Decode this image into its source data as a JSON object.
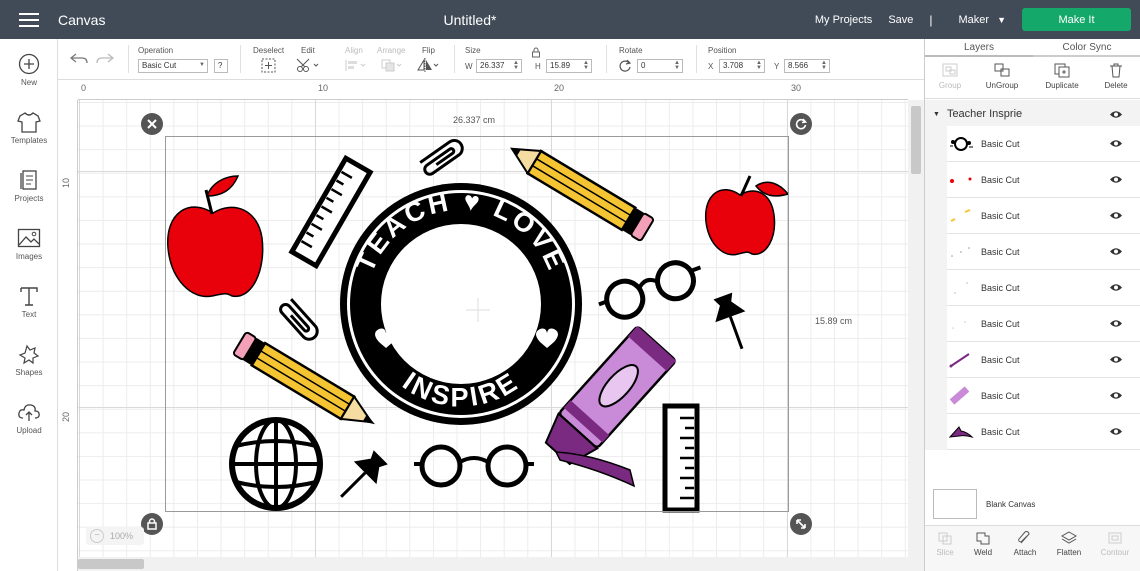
{
  "topbar": {
    "app_name": "Canvas",
    "doc_title": "Untitled*",
    "my_projects": "My Projects",
    "save": "Save",
    "separator": "|",
    "machine": "Maker",
    "make_it": "Make It"
  },
  "leftbar": {
    "new": "New",
    "templates": "Templates",
    "projects": "Projects",
    "images": "Images",
    "text": "Text",
    "shapes": "Shapes",
    "upload": "Upload"
  },
  "editbar": {
    "operation_label": "Operation",
    "operation_value": "Basic Cut",
    "help": "?",
    "deselect": "Deselect",
    "edit": "Edit",
    "align": "Align",
    "arrange": "Arrange",
    "flip": "Flip",
    "size_label": "Size",
    "w_label": "W",
    "w_value": "26.337",
    "h_label": "H",
    "h_value": "15.89",
    "rotate_label": "Rotate",
    "rotate_value": "0",
    "position_label": "Position",
    "x_label": "X",
    "x_value": "3.708",
    "y_label": "Y",
    "y_value": "8.566"
  },
  "ruler": {
    "h_ticks": [
      "0",
      "10",
      "20",
      "30"
    ],
    "v_ticks": [
      "10",
      "20"
    ]
  },
  "canvas": {
    "width_label": "26.337 cm",
    "height_label": "15.89 cm",
    "zoom": "100%"
  },
  "design": {
    "top_text": "TEACH ♥ LOVE",
    "bottom_text": "INSPIRE"
  },
  "panel": {
    "tab_layers": "Layers",
    "tab_color_sync": "Color Sync",
    "actions": {
      "group": "Group",
      "ungroup": "UnGroup",
      "duplicate": "Duplicate",
      "delete": "Delete"
    },
    "group_name": "Teacher Insprie",
    "layers": [
      "Basic Cut",
      "Basic Cut",
      "Basic Cut",
      "Basic Cut",
      "Basic Cut",
      "Basic Cut",
      "Basic Cut",
      "Basic Cut",
      "Basic Cut"
    ],
    "blank_canvas": "Blank Canvas",
    "bottom": {
      "slice": "Slice",
      "weld": "Weld",
      "attach": "Attach",
      "flatten": "Flatten",
      "contour": "Contour"
    }
  },
  "colors": {
    "topbar": "#414b57",
    "make_it": "#14a86b",
    "apple": "#e8000a",
    "pencil": "#f5c432",
    "crayon": "#c98bd8",
    "crayon_dark": "#7b2a82",
    "ink": "#000000"
  }
}
